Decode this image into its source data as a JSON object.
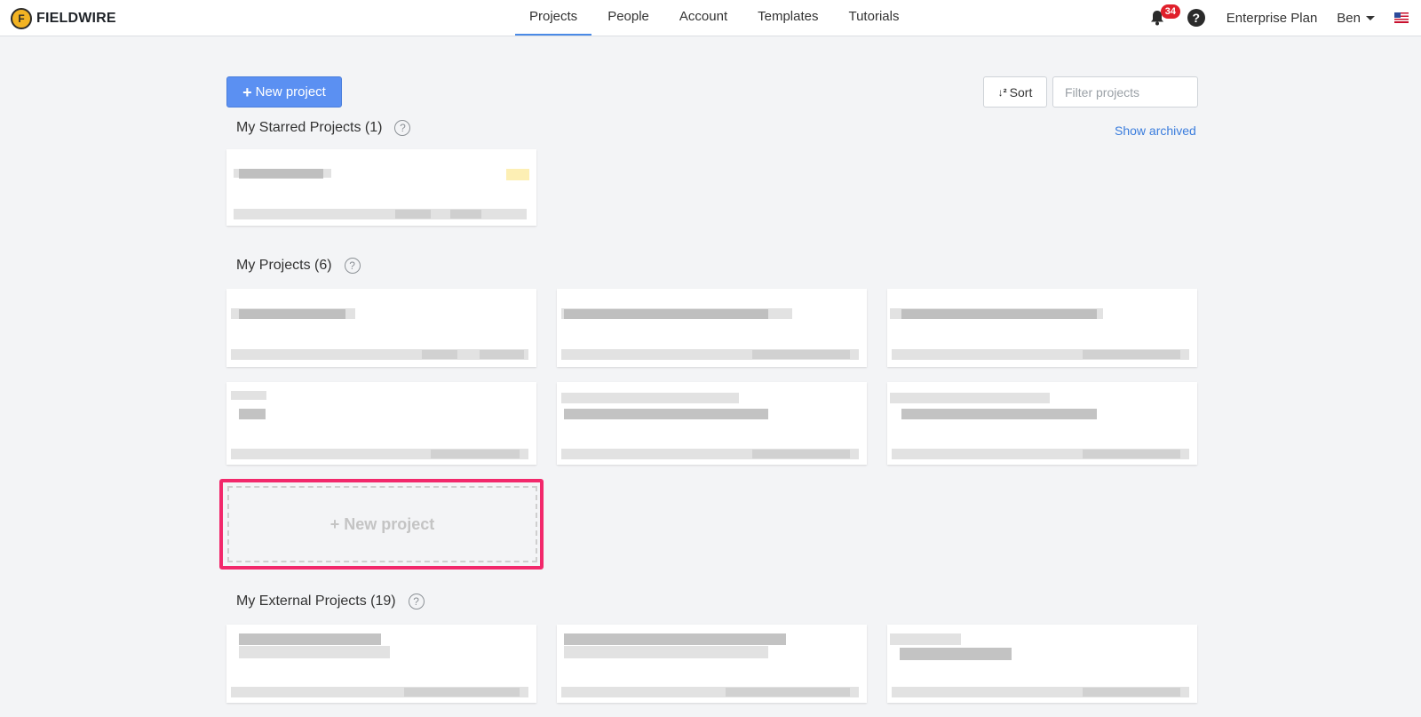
{
  "app": {
    "logo_text": "FIELDWIRE"
  },
  "nav": {
    "items": [
      "Projects",
      "People",
      "Account",
      "Templates",
      "Tutorials"
    ],
    "active": "Projects"
  },
  "header_right": {
    "notification_count": "34",
    "help_label": "?",
    "plan": "Enterprise Plan",
    "user": "Ben"
  },
  "toolbar": {
    "new_project_label": "New project",
    "sort_label": "Sort",
    "filter_placeholder": "Filter projects",
    "show_archived_label": "Show archived"
  },
  "sections": {
    "starred": {
      "title": "My Starred Projects (1)"
    },
    "my": {
      "title": "My Projects (6)"
    },
    "external": {
      "title": "My External Projects (19)"
    }
  },
  "new_project_card_label": "+ New project",
  "icons": {
    "logo": "fieldwire-helmet-icon",
    "bell": "bell-icon",
    "help": "help-circle-icon",
    "user_caret": "chevron-down-icon",
    "flag": "us-flag-icon",
    "plus": "plus-icon",
    "sort": "sort-icon",
    "section_help": "question-circle-icon"
  },
  "colors": {
    "primary": "#5b90f2",
    "link": "#3b7ddd",
    "badge": "#e0202b",
    "highlight": "#f2286b",
    "background": "#f3f4f6"
  }
}
